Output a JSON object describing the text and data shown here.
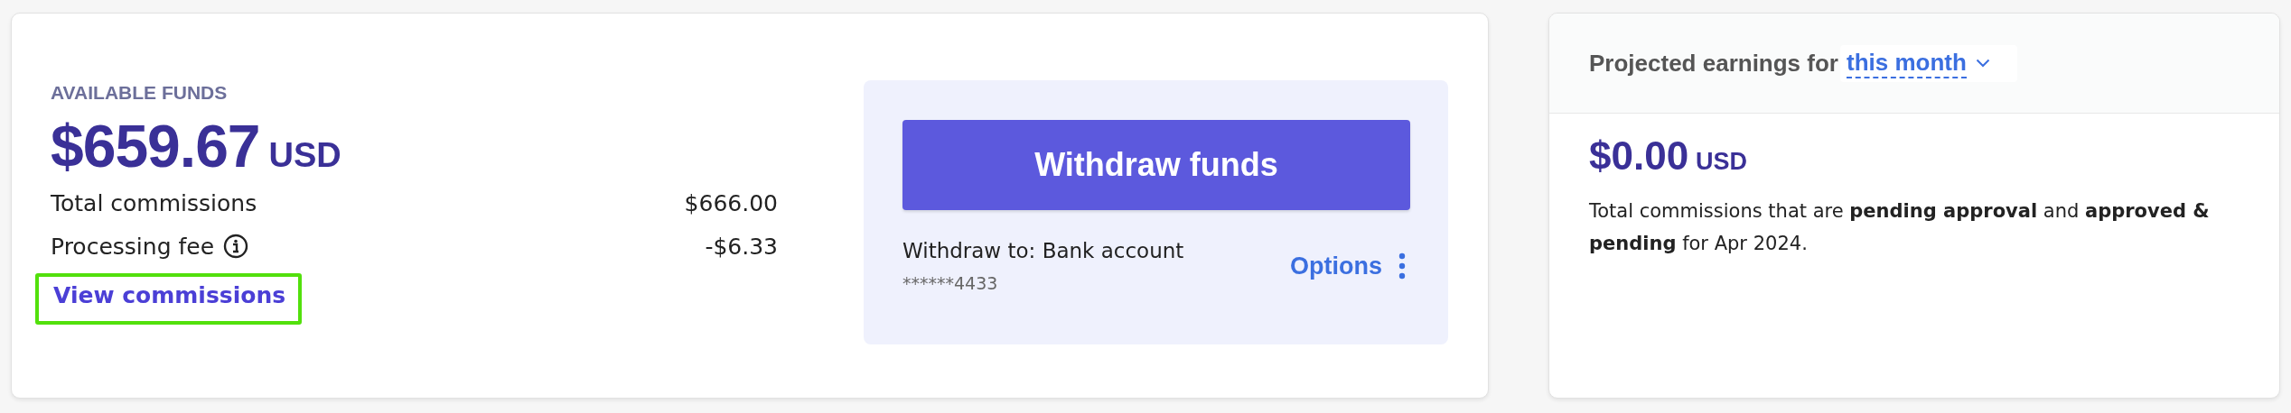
{
  "available_funds": {
    "label": "AVAILABLE FUNDS",
    "amount": "$659.67",
    "currency": "USD",
    "lines": [
      {
        "label": "Total commissions",
        "value": "$666.00",
        "info": false
      },
      {
        "label": "Processing fee",
        "value": "-$6.33",
        "info": true
      }
    ],
    "link": {
      "label": "View commissions",
      "highlighted": true
    }
  },
  "withdraw": {
    "button": "Withdraw funds",
    "destination": "Withdraw to: Bank account",
    "account": "******4433",
    "options": "Options"
  },
  "projected": {
    "title": "Projected earnings for",
    "period": "this month",
    "amount": "$0.00",
    "currency": "USD",
    "description": "Total commissions that are **pending approval** and **approved & pending** for Apr 2024."
  }
}
